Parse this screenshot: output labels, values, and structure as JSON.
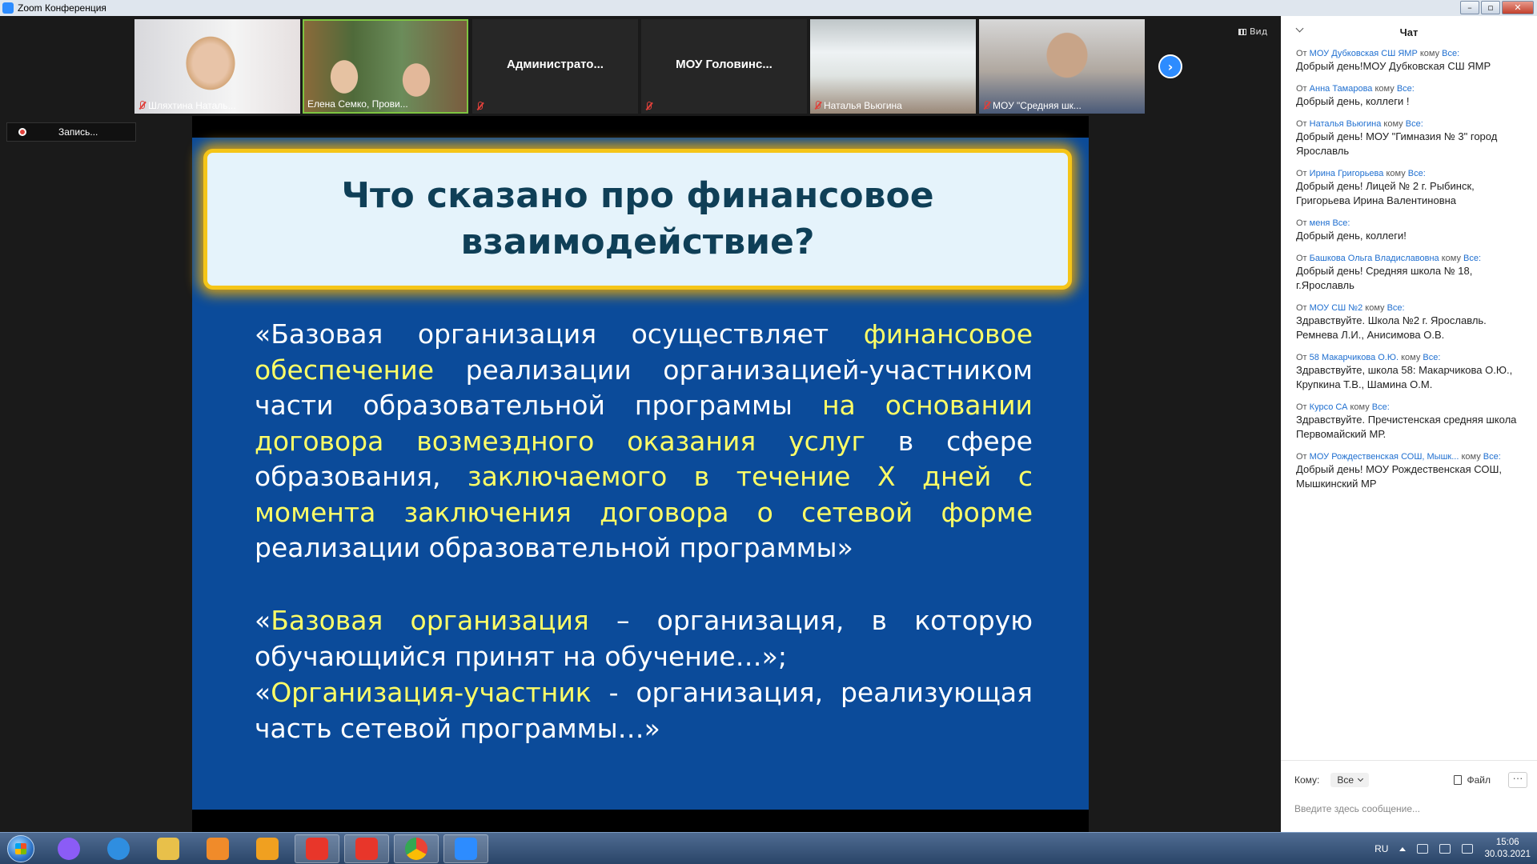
{
  "window": {
    "title": "Zoom Конференция"
  },
  "participants": [
    {
      "name": "Шляхтина Наталь...",
      "muted": true,
      "has_video": true
    },
    {
      "name": "Елена Семко, Прови...",
      "muted": false,
      "has_video": true,
      "active_speaker": true
    },
    {
      "name": "Администрато...",
      "muted": true,
      "has_video": false
    },
    {
      "name": "МОУ  Головинс...",
      "muted": true,
      "has_video": false
    },
    {
      "name": "Наталья Вьюгина",
      "muted": true,
      "has_video": true
    },
    {
      "name": "МОУ \"Средняя шк...",
      "muted": true,
      "has_video": true
    }
  ],
  "view_button": {
    "label": "Вид"
  },
  "recording": {
    "label": "Запись..."
  },
  "slide": {
    "title_line1": "Что сказано про финансовое",
    "title_line2": "взаимодействие?",
    "p1": {
      "t1": "«Базовая организация осуществляет ",
      "y1": "финансовое обеспечение",
      "t2": " реализации организацией-участником части образовательной программы ",
      "y2": "на основании договора возмездного оказания услуг",
      "t3": " в сфере образования, ",
      "y3": "заключаемого в течение Х дней с момента заключения договора о сетевой форме",
      "t4": " реализации образовательной программы»"
    },
    "p2": {
      "t1": "«",
      "y1": "Базовая организация",
      "t2": " – организация, в которую обучающийся принят на обучение…»;"
    },
    "p3": {
      "t1": "«",
      "y1": "Организация-участник",
      "t2": " - организация, реализующая часть сетевой программы…»"
    }
  },
  "chat": {
    "title": "Чат",
    "from_word": "От",
    "to_word": "кому",
    "messages": [
      {
        "from": "МОУ Дубковская СШ ЯМР",
        "to": "Все:",
        "text": "Добрый день!МОУ Дубковская СШ ЯМР"
      },
      {
        "from": "Анна Тамарова",
        "to": "Все:",
        "text": "Добрый  день, коллеги !"
      },
      {
        "from": "Наталья Вьюгина",
        "to": "Все:",
        "text": "Добрый день! МОУ \"Гимназия № 3\" город Ярославль"
      },
      {
        "from": "Ирина Григорьева",
        "to": "Все:",
        "text": "Добрый день! Лицей № 2 г. Рыбинск, Григорьева Ирина Валентиновна"
      },
      {
        "from": "меня",
        "to": "Все:",
        "text": "Добрый день, коллеги!",
        "self": true
      },
      {
        "from": "Башкова Ольга Владиславовна",
        "to": "Все:",
        "text": "Добрый день! Средняя школа № 18, г.Ярославль"
      },
      {
        "from": "МОУ СШ №2",
        "to": "Все:",
        "text": "Здравствуйте. Школа №2 г. Ярославль. Ремнева Л.И., Анисимова О.В."
      },
      {
        "from": "58 Макарчикова О.Ю.",
        "to": "Все:",
        "text": "Здравствуйте, школа 58: Макарчикова О.Ю., Крупкина Т.В., Шамина О.М."
      },
      {
        "from": "Курсо СА",
        "to": "Все:",
        "text": "Здравствуйте. Пречистенская средняя школа Первомайский МР."
      },
      {
        "from": "МОУ Рождественская СОШ, Мышк...",
        "to": "Все:",
        "text": "Добрый день! МОУ Рождественская СОШ, Мышкинский МР"
      }
    ],
    "to_label": "Кому:",
    "to_value": "Все",
    "file_label": "Файл",
    "more_label": "···",
    "input_placeholder": "Введите здесь сообщение..."
  },
  "taskbar": {
    "apps": [
      {
        "icon": "alice-icon",
        "color": "#8b5cf6"
      },
      {
        "icon": "internet-explorer-icon",
        "color": "#2f8ee0"
      },
      {
        "icon": "explorer-folder-icon",
        "color": "#e8c04a"
      },
      {
        "icon": "media-player-icon",
        "color": "#f08b2a"
      },
      {
        "icon": "outlook-icon",
        "color": "#f0a020"
      },
      {
        "icon": "yandex-browser-icon",
        "color": "#e8362a"
      },
      {
        "icon": "yandex-icon",
        "color": "#e8362a"
      },
      {
        "icon": "chrome-icon",
        "color": "#34a853"
      },
      {
        "icon": "zoom-icon",
        "color": "#2d8cff"
      }
    ],
    "lang": "RU",
    "time": "15:06",
    "date": "30.03.2021"
  },
  "colors": {
    "zoom_blue": "#2d8cff",
    "slide_bg": "#0b4b9a",
    "highlight": "#ffff66",
    "title_border": "#f5c518"
  }
}
